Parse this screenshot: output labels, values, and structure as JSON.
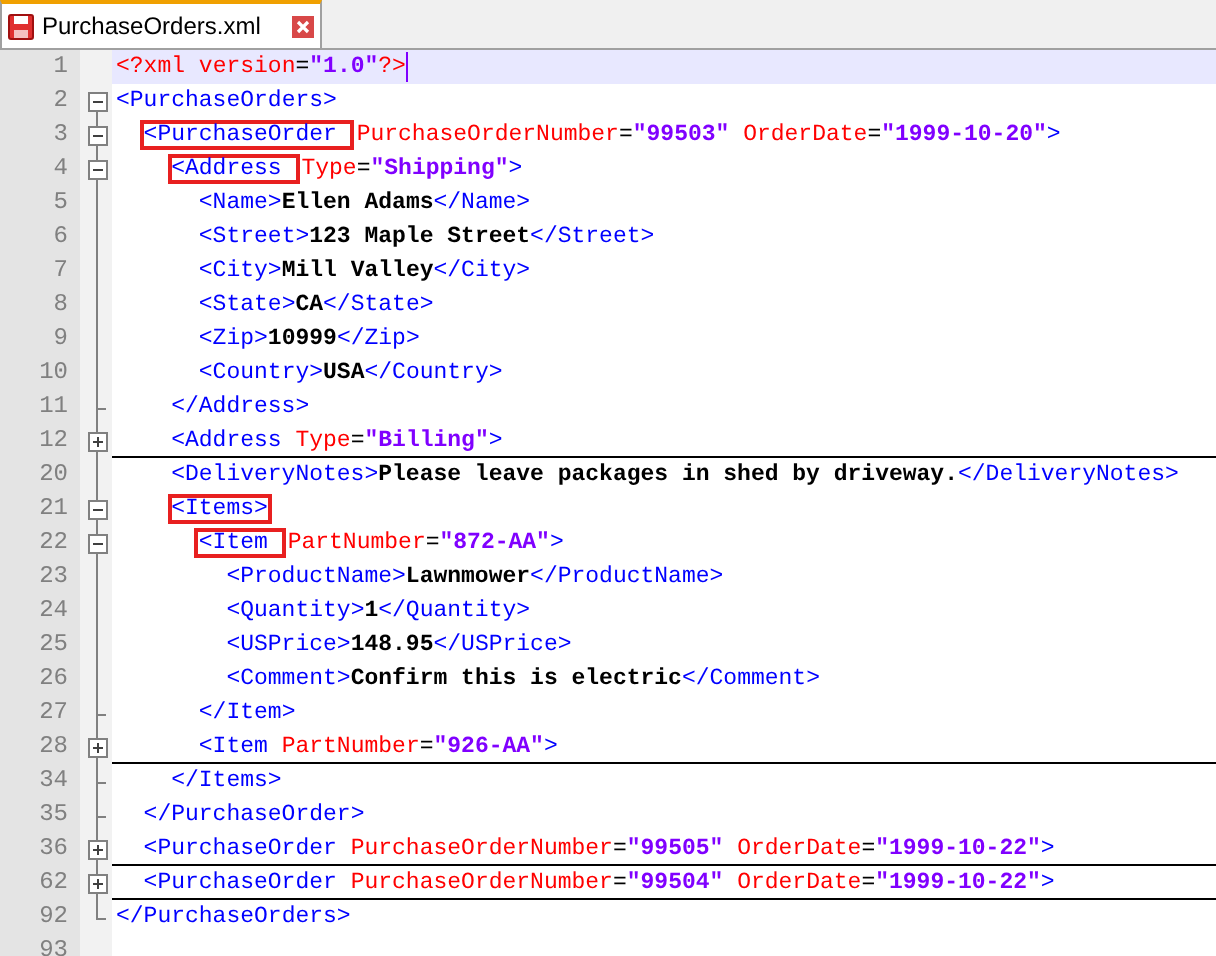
{
  "tabs": [
    {
      "title": "PurchaseOrders.xml",
      "selected": true,
      "modified": true
    }
  ],
  "lines": [
    {
      "number": "1",
      "kind": "declaration",
      "current": true,
      "tokens": [
        {
          "kind": "pi",
          "text": "<?xml "
        },
        {
          "kind": "attr",
          "text": "version"
        },
        {
          "kind": "eq",
          "text": "="
        },
        {
          "kind": "value",
          "text": "\"1.0\""
        },
        {
          "kind": "pi",
          "text": "?>"
        }
      ]
    },
    {
      "number": "2",
      "kind": "start",
      "expanded": true,
      "tokens": [
        {
          "kind": "tag",
          "text": "<PurchaseOrders>"
        }
      ],
      "children": [
        {
          "number": "3",
          "kind": "start",
          "expanded": true,
          "tokens": [
            {
              "kind": "tag",
              "text": "<PurchaseOrder ",
              "boxed": true
            },
            {
              "kind": "attr",
              "text": "PurchaseOrderNumber"
            },
            {
              "kind": "eq",
              "text": "="
            },
            {
              "kind": "value",
              "text": "\"99503\""
            },
            {
              "kind": "attr",
              "text": " OrderDate"
            },
            {
              "kind": "eq",
              "text": "="
            },
            {
              "kind": "value",
              "text": "\"1999-10-20\""
            },
            {
              "kind": "tag",
              "text": ">"
            }
          ],
          "children": [
            {
              "number": "4",
              "kind": "start",
              "expanded": true,
              "tokens": [
                {
                  "kind": "tag",
                  "text": "<Address ",
                  "boxed": true
                },
                {
                  "kind": "attr",
                  "text": "Type"
                },
                {
                  "kind": "eq",
                  "text": "="
                },
                {
                  "kind": "value",
                  "text": "\"Shipping\""
                },
                {
                  "kind": "tag",
                  "text": ">"
                }
              ],
              "children": [
                {
                  "number": "5",
                  "kind": "element",
                  "tokens": [
                    {
                      "kind": "tag",
                      "text": "<Name>"
                    },
                    {
                      "kind": "text",
                      "text": "Ellen Adams"
                    },
                    {
                      "kind": "tag",
                      "text": "</Name>"
                    }
                  ]
                },
                {
                  "number": "6",
                  "kind": "element",
                  "tokens": [
                    {
                      "kind": "tag",
                      "text": "<Street>"
                    },
                    {
                      "kind": "text",
                      "text": "123 Maple Street"
                    },
                    {
                      "kind": "tag",
                      "text": "</Street>"
                    }
                  ]
                },
                {
                  "number": "7",
                  "kind": "element",
                  "tokens": [
                    {
                      "kind": "tag",
                      "text": "<City>"
                    },
                    {
                      "kind": "text",
                      "text": "Mill Valley"
                    },
                    {
                      "kind": "tag",
                      "text": "</City>"
                    }
                  ]
                },
                {
                  "number": "8",
                  "kind": "element",
                  "tokens": [
                    {
                      "kind": "tag",
                      "text": "<State>"
                    },
                    {
                      "kind": "text",
                      "text": "CA"
                    },
                    {
                      "kind": "tag",
                      "text": "</State>"
                    }
                  ]
                },
                {
                  "number": "9",
                  "kind": "element",
                  "tokens": [
                    {
                      "kind": "tag",
                      "text": "<Zip>"
                    },
                    {
                      "kind": "text",
                      "text": "10999"
                    },
                    {
                      "kind": "tag",
                      "text": "</Zip>"
                    }
                  ]
                },
                {
                  "number": "10",
                  "kind": "element",
                  "tokens": [
                    {
                      "kind": "tag",
                      "text": "<Country>"
                    },
                    {
                      "kind": "text",
                      "text": "USA"
                    },
                    {
                      "kind": "tag",
                      "text": "</Country>"
                    }
                  ]
                }
              ]
            },
            {
              "number": "11",
              "kind": "end",
              "tokens": [
                {
                  "kind": "tag",
                  "text": "</Address>"
                }
              ]
            },
            {
              "number": "12",
              "kind": "start",
              "expanded": false,
              "tokens": [
                {
                  "kind": "tag",
                  "text": "<Address "
                },
                {
                  "kind": "attr",
                  "text": "Type"
                },
                {
                  "kind": "eq",
                  "text": "="
                },
                {
                  "kind": "value",
                  "text": "\"Billing\""
                },
                {
                  "kind": "tag",
                  "text": ">"
                }
              ]
            },
            {
              "number": "20",
              "kind": "element",
              "tokens": [
                {
                  "kind": "tag",
                  "text": "<DeliveryNotes>"
                },
                {
                  "kind": "text",
                  "text": "Please leave packages in shed by driveway."
                },
                {
                  "kind": "tag",
                  "text": "</DeliveryNotes>"
                }
              ]
            },
            {
              "number": "21",
              "kind": "start",
              "expanded": true,
              "tokens": [
                {
                  "kind": "tag",
                  "text": "<Items>",
                  "boxed": true
                }
              ],
              "children": [
                {
                  "number": "22",
                  "kind": "start",
                  "expanded": true,
                  "tokens": [
                    {
                      "kind": "tag",
                      "text": "<Item ",
                      "boxed": true
                    },
                    {
                      "kind": "attr",
                      "text": "PartNumber"
                    },
                    {
                      "kind": "eq",
                      "text": "="
                    },
                    {
                      "kind": "value",
                      "text": "\"872-AA\""
                    },
                    {
                      "kind": "tag",
                      "text": ">"
                    }
                  ],
                  "children": [
                    {
                      "number": "23",
                      "kind": "element",
                      "tokens": [
                        {
                          "kind": "tag",
                          "text": "<ProductName>"
                        },
                        {
                          "kind": "text",
                          "text": "Lawnmower"
                        },
                        {
                          "kind": "tag",
                          "text": "</ProductName>"
                        }
                      ]
                    },
                    {
                      "number": "24",
                      "kind": "element",
                      "tokens": [
                        {
                          "kind": "tag",
                          "text": "<Quantity>"
                        },
                        {
                          "kind": "text",
                          "text": "1"
                        },
                        {
                          "kind": "tag",
                          "text": "</Quantity>"
                        }
                      ]
                    },
                    {
                      "number": "25",
                      "kind": "element",
                      "tokens": [
                        {
                          "kind": "tag",
                          "text": "<USPrice>"
                        },
                        {
                          "kind": "text",
                          "text": "148.95"
                        },
                        {
                          "kind": "tag",
                          "text": "</USPrice>"
                        }
                      ]
                    },
                    {
                      "number": "26",
                      "kind": "element",
                      "tokens": [
                        {
                          "kind": "tag",
                          "text": "<Comment>"
                        },
                        {
                          "kind": "text",
                          "text": "Confirm this is electric"
                        },
                        {
                          "kind": "tag",
                          "text": "</Comment>"
                        }
                      ]
                    }
                  ]
                },
                {
                  "number": "27",
                  "kind": "end",
                  "tokens": [
                    {
                      "kind": "tag",
                      "text": "</Item>"
                    }
                  ]
                },
                {
                  "number": "28",
                  "kind": "start",
                  "expanded": false,
                  "tokens": [
                    {
                      "kind": "tag",
                      "text": "<Item "
                    },
                    {
                      "kind": "attr",
                      "text": "PartNumber"
                    },
                    {
                      "kind": "eq",
                      "text": "="
                    },
                    {
                      "kind": "value",
                      "text": "\"926-AA\""
                    },
                    {
                      "kind": "tag",
                      "text": ">"
                    }
                  ]
                }
              ]
            },
            {
              "number": "34",
              "kind": "end",
              "tokens": [
                {
                  "kind": "tag",
                  "text": "</Items>"
                }
              ]
            }
          ]
        },
        {
          "number": "35",
          "kind": "end",
          "tokens": [
            {
              "kind": "tag",
              "text": "</PurchaseOrder>"
            }
          ]
        },
        {
          "number": "36",
          "kind": "start",
          "expanded": false,
          "tokens": [
            {
              "kind": "tag",
              "text": "<PurchaseOrder "
            },
            {
              "kind": "attr",
              "text": "PurchaseOrderNumber"
            },
            {
              "kind": "eq",
              "text": "="
            },
            {
              "kind": "value",
              "text": "\"99505\""
            },
            {
              "kind": "attr",
              "text": " OrderDate"
            },
            {
              "kind": "eq",
              "text": "="
            },
            {
              "kind": "value",
              "text": "\"1999-10-22\""
            },
            {
              "kind": "tag",
              "text": ">"
            }
          ]
        },
        {
          "number": "62",
          "kind": "start",
          "expanded": false,
          "tokens": [
            {
              "kind": "tag",
              "text": "<PurchaseOrder "
            },
            {
              "kind": "attr",
              "text": "PurchaseOrderNumber"
            },
            {
              "kind": "eq",
              "text": "="
            },
            {
              "kind": "value",
              "text": "\"99504\""
            },
            {
              "kind": "attr",
              "text": " OrderDate"
            },
            {
              "kind": "eq",
              "text": "="
            },
            {
              "kind": "value",
              "text": "\"1999-10-22\""
            },
            {
              "kind": "tag",
              "text": ">"
            }
          ]
        }
      ]
    },
    {
      "number": "92",
      "kind": "end",
      "tokens": [
        {
          "kind": "tag",
          "text": "</PurchaseOrders>"
        }
      ]
    },
    {
      "number": "93",
      "kind": "blank"
    }
  ]
}
